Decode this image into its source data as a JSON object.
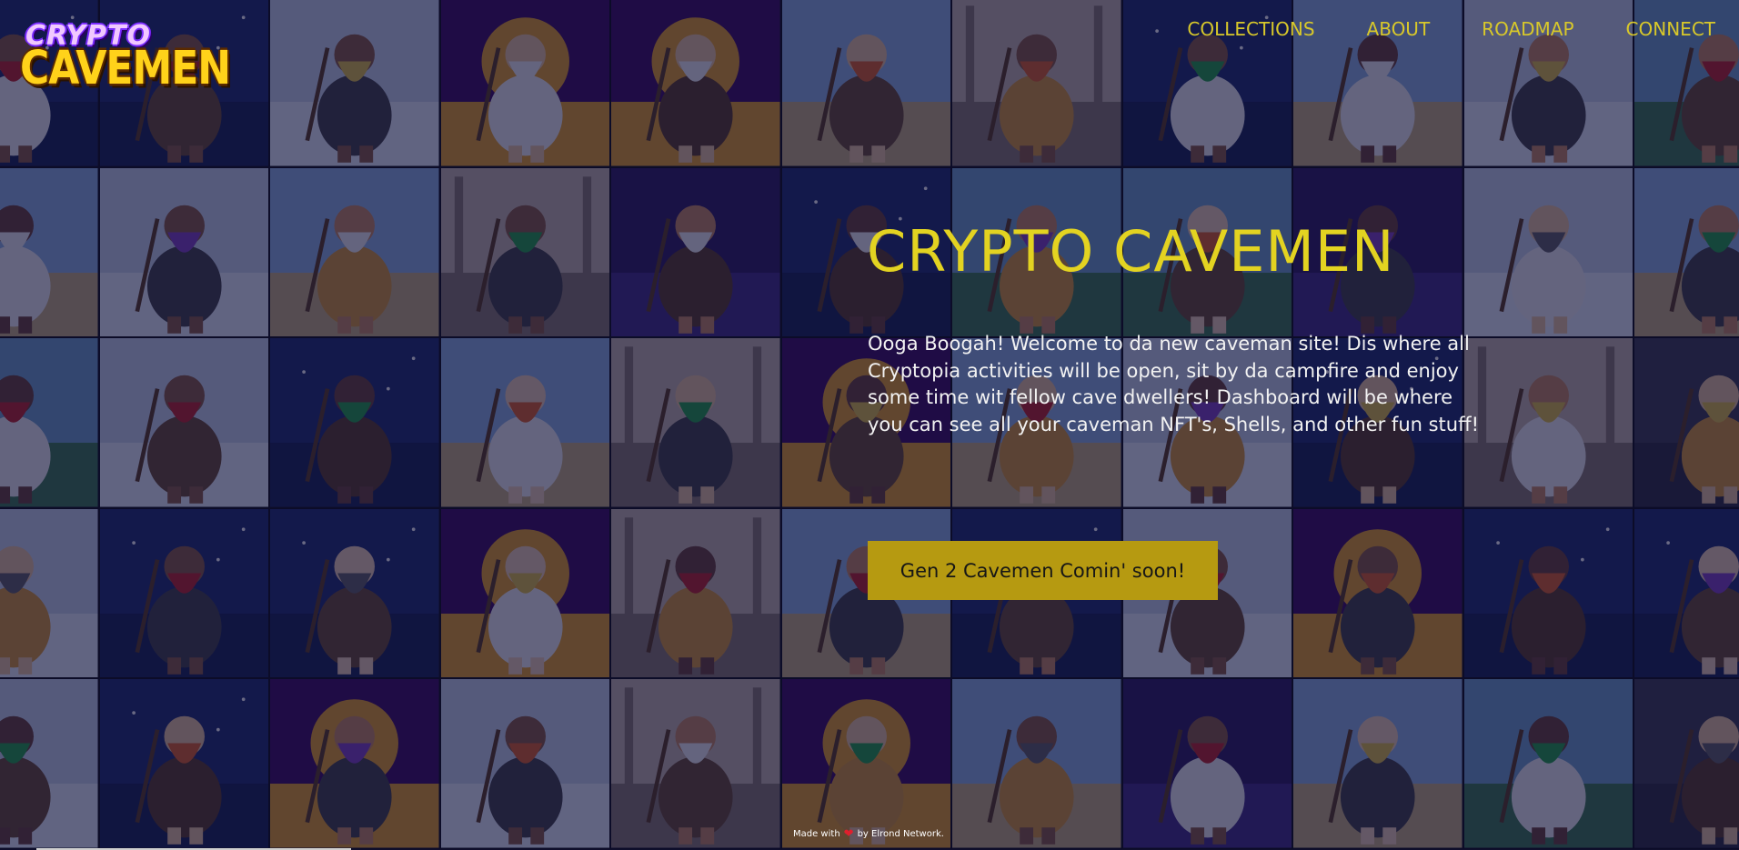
{
  "brand": {
    "logo_top": "CRYPTO",
    "logo_bottom": "CAVEMEN",
    "colors": {
      "accent": "#e3d321",
      "button": "#b69a11",
      "overlay": "#0e0e38"
    }
  },
  "nav": {
    "items": [
      {
        "label": "COLLECTIONS"
      },
      {
        "label": "ABOUT"
      },
      {
        "label": "ROADMAP"
      },
      {
        "label": "CONNECT"
      }
    ]
  },
  "hero": {
    "title": "CRYPTO CAVEMEN",
    "text": "Ooga Boogah! Welcome to da new caveman site! Dis where all Cryptopia activities will be open, sit by da campfire and enjoy some time wit fellow cave dwellers! Dashboard will be where you can see all your caveman NFT's, Shells, and other fun stuff!",
    "cta_label": "Gen 2 Cavemen Comin' soon!"
  },
  "footer": {
    "made_with": "Made with",
    "heart_icon": "heart-icon",
    "by_text": "by Elrond Network."
  },
  "background": {
    "tile_icon": "caveman-nft-art",
    "scenes": [
      "forest",
      "savanna",
      "waterfall",
      "space",
      "snow",
      "synthwave",
      "cave",
      "storm"
    ]
  }
}
